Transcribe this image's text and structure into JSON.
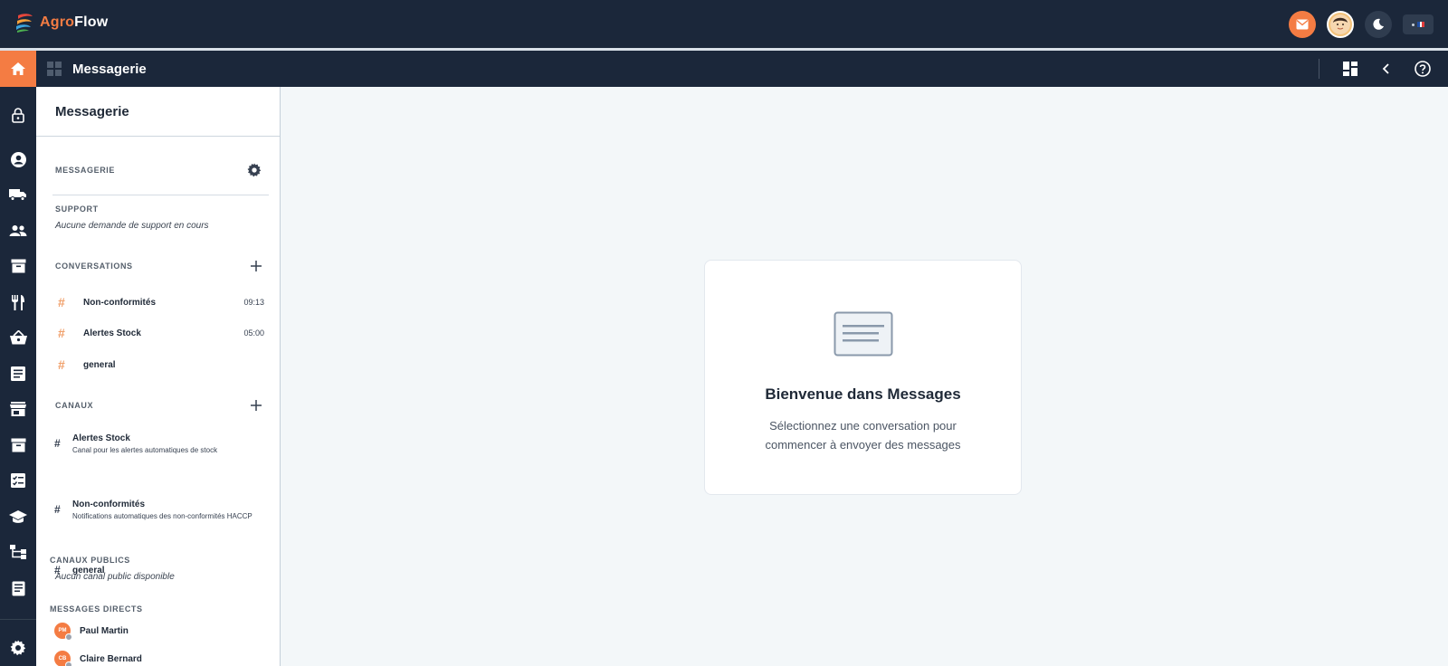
{
  "app": {
    "brand_part1": "Agro",
    "brand_part2": "Flow"
  },
  "header": {
    "title": "Messagerie",
    "actions": [
      "mail-icon",
      "avatar",
      "moon-icon",
      "language-flag"
    ],
    "language": "FR"
  },
  "sidebar": {
    "title": "Messagerie",
    "messaging_label": "MESSAGERIE",
    "support": {
      "label": "SUPPORT",
      "empty": "Aucune demande de support en cours"
    },
    "conversations": {
      "label": "CONVERSATIONS",
      "items": [
        {
          "name": "Non-conformités",
          "time": "09:13"
        },
        {
          "name": "Alertes Stock",
          "time": "05:00"
        },
        {
          "name": "general",
          "time": ""
        }
      ]
    },
    "channels": {
      "label": "CANAUX",
      "items": [
        {
          "name": "Alertes Stock",
          "desc": "Canal pour les alertes automatiques de stock"
        },
        {
          "name": "general",
          "desc": ""
        },
        {
          "name": "Non-conformités",
          "desc": "Notifications automatiques des non-conformités HACCP"
        }
      ]
    },
    "public_channels": {
      "label": "CANAUX PUBLICS",
      "empty": "Aucun canal public disponible"
    },
    "direct_messages": {
      "label": "MESSAGES DIRECTS",
      "items": [
        {
          "initials": "PM",
          "name": "Paul Martin"
        },
        {
          "initials": "CB",
          "name": "Claire Bernard"
        }
      ]
    }
  },
  "welcome": {
    "title": "Bienvenue dans Messages",
    "subtitle": "Sélectionnez une conversation pour commencer à envoyer des messages"
  },
  "colors": {
    "accent": "#f47c43",
    "navbar": "#1b273a",
    "background": "#f3f7f9"
  }
}
